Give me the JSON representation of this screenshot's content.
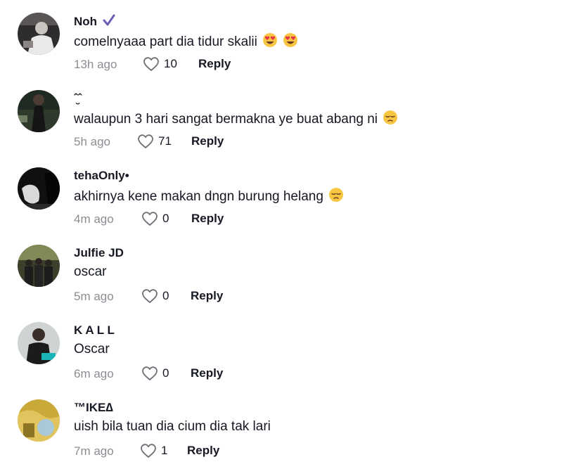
{
  "comments": [
    {
      "username": "Noh",
      "verified": true,
      "text": "comelnyaaa part dia tidur skalii",
      "emojis": [
        "heart-eyes",
        "heart-eyes"
      ],
      "time": "13h ago",
      "likes": "10",
      "reply_label": "Reply"
    },
    {
      "username": "ˆ̮ˆ",
      "text": "walaupun 3 hari sangat bermakna ye buat abang ni ",
      "emojis": [
        "pensive"
      ],
      "time": "5h ago",
      "likes": "71",
      "reply_label": "Reply"
    },
    {
      "username": "tehaOnly•",
      "text": "akhirnya kene makan dngn burung helang",
      "emojis": [
        "pensive"
      ],
      "time": "4m ago",
      "likes": "0",
      "reply_label": "Reply"
    },
    {
      "username": "Julfie JD",
      "text": "oscar",
      "time": "5m ago",
      "likes": "0",
      "reply_label": "Reply"
    },
    {
      "username": "K A L L",
      "text": "Oscar",
      "time": "6m ago",
      "likes": "0",
      "reply_label": "Reply"
    },
    {
      "username": "™IKE∆",
      "text": "uish bila tuan dia cium dia tak lari",
      "time": "7m ago",
      "likes": "1",
      "reply_label": "Reply"
    }
  ],
  "icons": {
    "like": "heart-outline-icon",
    "verified": "checkmark-icon"
  },
  "colors": {
    "verified": "#6b5fb5",
    "emoji_face": "#f7c744"
  }
}
